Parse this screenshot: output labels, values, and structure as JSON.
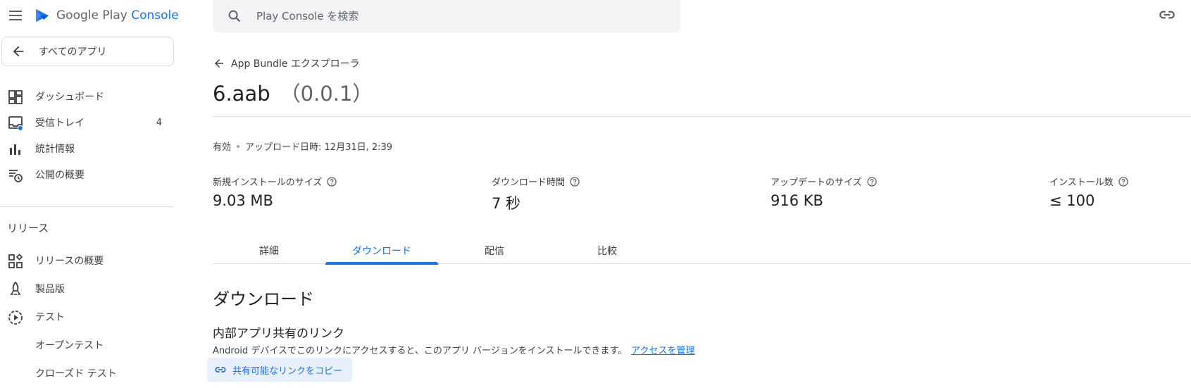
{
  "app": {
    "brand_name": "Google Play",
    "brand_accent": "Console",
    "brand_color": "#1a73e8"
  },
  "search": {
    "placeholder": "Play Console を検索"
  },
  "sidebar": {
    "all_apps_label": "すべてのアプリ",
    "items": [
      {
        "label": "ダッシュボード",
        "icon": "dashboard-icon"
      },
      {
        "label": "受信トレイ",
        "icon": "inbox-icon",
        "count": "4"
      },
      {
        "label": "統計情報",
        "icon": "bar-chart-icon"
      },
      {
        "label": "公開の概要",
        "icon": "publishing-overview-icon"
      }
    ],
    "section_label": "リリース",
    "release_items": [
      {
        "label": "リリースの概要",
        "icon": "release-overview-icon"
      },
      {
        "label": "製品版",
        "icon": "production-icon"
      },
      {
        "label": "テスト",
        "icon": "testing-icon"
      },
      {
        "label": "オープンテスト"
      },
      {
        "label": "クローズド テスト"
      }
    ]
  },
  "main": {
    "breadcrumb": "App Bundle エクスプローラ",
    "title": "6.aab",
    "version": "（0.0.1）",
    "status": "有効",
    "upload_date": "アップロード日時: 12月31日, 2:39",
    "stats": [
      {
        "label": "新規インストールのサイズ",
        "value": "9.03 MB"
      },
      {
        "label": "ダウンロード時間",
        "value": "7 秒"
      },
      {
        "label": "アップデートのサイズ",
        "value": "916 KB"
      },
      {
        "label": "インストール数",
        "value": "≤ 100"
      }
    ],
    "tabs": [
      {
        "label": "詳細"
      },
      {
        "label": "ダウンロード",
        "active": true
      },
      {
        "label": "配信"
      },
      {
        "label": "比較"
      }
    ],
    "section_title": "ダウンロード",
    "subsection_title": "内部アプリ共有のリンク",
    "description": "Android デバイスでこのリンクにアクセスすると、このアプリ バージョンをインストールできます。",
    "manage_access_link": "アクセスを管理",
    "copy_button_label": "共有可能なリンクをコピー"
  }
}
